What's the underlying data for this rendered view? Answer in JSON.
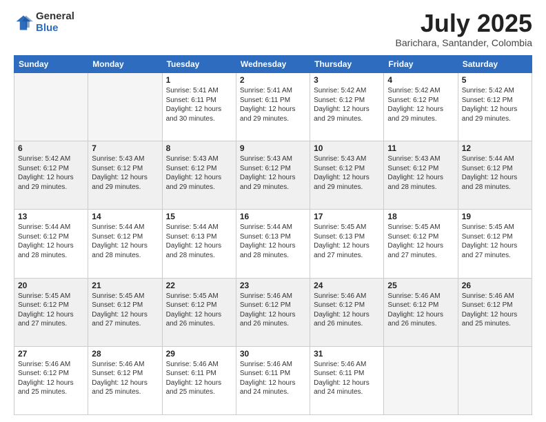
{
  "header": {
    "logo_general": "General",
    "logo_blue": "Blue",
    "month_title": "July 2025",
    "location": "Barichara, Santander, Colombia"
  },
  "weekdays": [
    "Sunday",
    "Monday",
    "Tuesday",
    "Wednesday",
    "Thursday",
    "Friday",
    "Saturday"
  ],
  "weeks": [
    [
      {
        "day": "",
        "info": ""
      },
      {
        "day": "",
        "info": ""
      },
      {
        "day": "1",
        "info": "Sunrise: 5:41 AM\nSunset: 6:11 PM\nDaylight: 12 hours and 30 minutes."
      },
      {
        "day": "2",
        "info": "Sunrise: 5:41 AM\nSunset: 6:11 PM\nDaylight: 12 hours and 29 minutes."
      },
      {
        "day": "3",
        "info": "Sunrise: 5:42 AM\nSunset: 6:12 PM\nDaylight: 12 hours and 29 minutes."
      },
      {
        "day": "4",
        "info": "Sunrise: 5:42 AM\nSunset: 6:12 PM\nDaylight: 12 hours and 29 minutes."
      },
      {
        "day": "5",
        "info": "Sunrise: 5:42 AM\nSunset: 6:12 PM\nDaylight: 12 hours and 29 minutes."
      }
    ],
    [
      {
        "day": "6",
        "info": "Sunrise: 5:42 AM\nSunset: 6:12 PM\nDaylight: 12 hours and 29 minutes."
      },
      {
        "day": "7",
        "info": "Sunrise: 5:43 AM\nSunset: 6:12 PM\nDaylight: 12 hours and 29 minutes."
      },
      {
        "day": "8",
        "info": "Sunrise: 5:43 AM\nSunset: 6:12 PM\nDaylight: 12 hours and 29 minutes."
      },
      {
        "day": "9",
        "info": "Sunrise: 5:43 AM\nSunset: 6:12 PM\nDaylight: 12 hours and 29 minutes."
      },
      {
        "day": "10",
        "info": "Sunrise: 5:43 AM\nSunset: 6:12 PM\nDaylight: 12 hours and 29 minutes."
      },
      {
        "day": "11",
        "info": "Sunrise: 5:43 AM\nSunset: 6:12 PM\nDaylight: 12 hours and 28 minutes."
      },
      {
        "day": "12",
        "info": "Sunrise: 5:44 AM\nSunset: 6:12 PM\nDaylight: 12 hours and 28 minutes."
      }
    ],
    [
      {
        "day": "13",
        "info": "Sunrise: 5:44 AM\nSunset: 6:12 PM\nDaylight: 12 hours and 28 minutes."
      },
      {
        "day": "14",
        "info": "Sunrise: 5:44 AM\nSunset: 6:12 PM\nDaylight: 12 hours and 28 minutes."
      },
      {
        "day": "15",
        "info": "Sunrise: 5:44 AM\nSunset: 6:13 PM\nDaylight: 12 hours and 28 minutes."
      },
      {
        "day": "16",
        "info": "Sunrise: 5:44 AM\nSunset: 6:13 PM\nDaylight: 12 hours and 28 minutes."
      },
      {
        "day": "17",
        "info": "Sunrise: 5:45 AM\nSunset: 6:13 PM\nDaylight: 12 hours and 27 minutes."
      },
      {
        "day": "18",
        "info": "Sunrise: 5:45 AM\nSunset: 6:12 PM\nDaylight: 12 hours and 27 minutes."
      },
      {
        "day": "19",
        "info": "Sunrise: 5:45 AM\nSunset: 6:12 PM\nDaylight: 12 hours and 27 minutes."
      }
    ],
    [
      {
        "day": "20",
        "info": "Sunrise: 5:45 AM\nSunset: 6:12 PM\nDaylight: 12 hours and 27 minutes."
      },
      {
        "day": "21",
        "info": "Sunrise: 5:45 AM\nSunset: 6:12 PM\nDaylight: 12 hours and 27 minutes."
      },
      {
        "day": "22",
        "info": "Sunrise: 5:45 AM\nSunset: 6:12 PM\nDaylight: 12 hours and 26 minutes."
      },
      {
        "day": "23",
        "info": "Sunrise: 5:46 AM\nSunset: 6:12 PM\nDaylight: 12 hours and 26 minutes."
      },
      {
        "day": "24",
        "info": "Sunrise: 5:46 AM\nSunset: 6:12 PM\nDaylight: 12 hours and 26 minutes."
      },
      {
        "day": "25",
        "info": "Sunrise: 5:46 AM\nSunset: 6:12 PM\nDaylight: 12 hours and 26 minutes."
      },
      {
        "day": "26",
        "info": "Sunrise: 5:46 AM\nSunset: 6:12 PM\nDaylight: 12 hours and 25 minutes."
      }
    ],
    [
      {
        "day": "27",
        "info": "Sunrise: 5:46 AM\nSunset: 6:12 PM\nDaylight: 12 hours and 25 minutes."
      },
      {
        "day": "28",
        "info": "Sunrise: 5:46 AM\nSunset: 6:12 PM\nDaylight: 12 hours and 25 minutes."
      },
      {
        "day": "29",
        "info": "Sunrise: 5:46 AM\nSunset: 6:11 PM\nDaylight: 12 hours and 25 minutes."
      },
      {
        "day": "30",
        "info": "Sunrise: 5:46 AM\nSunset: 6:11 PM\nDaylight: 12 hours and 24 minutes."
      },
      {
        "day": "31",
        "info": "Sunrise: 5:46 AM\nSunset: 6:11 PM\nDaylight: 12 hours and 24 minutes."
      },
      {
        "day": "",
        "info": ""
      },
      {
        "day": "",
        "info": ""
      }
    ]
  ]
}
